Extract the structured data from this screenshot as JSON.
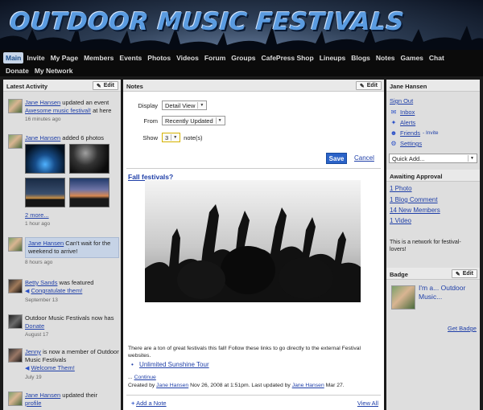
{
  "site": {
    "title": "OUTDOOR MUSIC FESTIVALS"
  },
  "nav": {
    "row1": [
      "Main",
      "Invite",
      "My Page",
      "Members",
      "Events",
      "Photos",
      "Videos",
      "Forum",
      "Groups",
      "CafePress Shop",
      "Lineups",
      "Blogs",
      "Notes",
      "Games",
      "Chat"
    ],
    "row2": [
      "Donate",
      "My Network"
    ],
    "active": "Main"
  },
  "left": {
    "title": "Latest Activity",
    "edit_label": "Edit",
    "items": [
      {
        "user": "Jane Hansen",
        "text": " updated an event",
        "link": "Awesome music festival!",
        "tail": " at here",
        "ago": "16 minutes ago"
      },
      {
        "user": "Jane Hansen",
        "text": " added 6 photos",
        "more": "2 more...",
        "ago": "1 hour ago"
      },
      {
        "user": "Jane Hansen",
        "text": " Can't wait for the weekend to arrive!",
        "ago": "8 hours ago"
      },
      {
        "user": "Betty Sands",
        "text": " was featured",
        "link": "Congratulate them!",
        "ago": "September 13"
      },
      {
        "text": "Outdoor Music Festivals now has ",
        "link": "Donate",
        "ago": "August 17"
      },
      {
        "user": "Jenny",
        "text": " is now a member of Outdoor Music Festivals",
        "link": "Welcome Them!",
        "ago": "July 19"
      },
      {
        "user": "Jane Hansen",
        "text": " updated their",
        "link": "profile"
      }
    ]
  },
  "notes": {
    "title": "Notes",
    "edit_label": "Edit",
    "display_label": "Display",
    "display_value": "Detail View",
    "from_label": "From",
    "from_value": "Recently Updated",
    "show_label": "Show",
    "show_value": "3",
    "show_suffix": "note(s)",
    "save_label": "Save",
    "cancel_label": "Cancel",
    "post_title": "Fall festivals?",
    "body": "There are a ton of great festivals this fall! Follow these links to go directly to the external Festival websites.",
    "bullet_link": "Unlimited Sunshine Tour",
    "continue_prefix": "... ",
    "continue_label": "Continue",
    "meta_prefix": "Created by ",
    "meta_author": "Jane Hansen",
    "meta_mid": " Nov 26, 2008 at 1:51pm. Last updated by ",
    "meta_updater": "Jane Hansen",
    "meta_suffix": " Mar 27.",
    "add_note_label": "Add a Note",
    "view_all_label": "View All"
  },
  "right": {
    "user_title": "Jane Hansen",
    "sign_out": "Sign Out",
    "inbox": "Inbox",
    "alerts": "Alerts",
    "friends": "Friends",
    "invite": "- Invite",
    "settings": "Settings",
    "quick_add": "Quick Add...",
    "approval_title": "Awaiting Approval",
    "approval_items": [
      "1 Photo",
      "1 Blog Comment",
      "14 New Members",
      "1 Video"
    ],
    "network_text": "This is a network for festival-lovers!",
    "badge_title": "Badge",
    "badge_edit": "Edit",
    "badge_text": "I'm a... Outdoor Music...",
    "get_badge": "Get Badge"
  },
  "colors": {
    "link": "#1f3fa8",
    "save_button": "#2b63c8",
    "nav_bg": "#0b0b0b",
    "active_tab": "#c8d6e8"
  }
}
